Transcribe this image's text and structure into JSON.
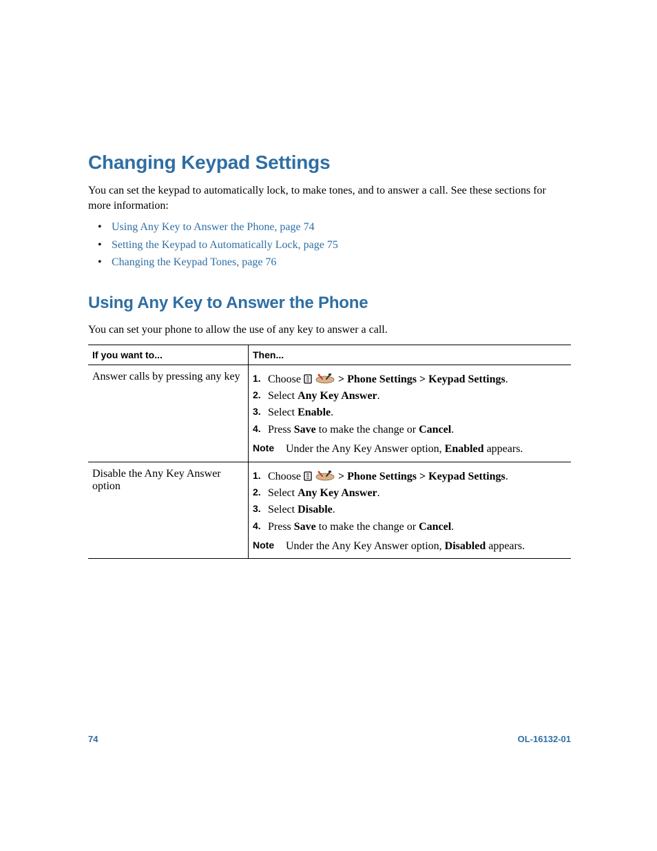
{
  "headings": {
    "h1": "Changing Keypad Settings",
    "h2": "Using Any Key to Answer the Phone"
  },
  "intro": "You can set the keypad to automatically lock, to make tones, and to answer a call. See these sections for more information:",
  "links": [
    "Using Any Key to Answer the Phone, page 74",
    "Setting the Keypad to Automatically Lock, page 75",
    "Changing the Keypad Tones, page 76"
  ],
  "section_intro": "You can set your phone to allow the use of any key to answer a call.",
  "table": {
    "headers": [
      "If you want to...",
      "Then..."
    ],
    "rows": [
      {
        "want": "Answer calls by pressing any key",
        "steps": [
          {
            "prefix": "Choose ",
            "icons": true,
            "suffix_bold": " > Phone Settings > Keypad Settings",
            "tail": "."
          },
          {
            "prefix": "Select ",
            "bold": "Any Key Answer",
            "tail": "."
          },
          {
            "prefix": "Select ",
            "bold": "Enable",
            "tail": "."
          },
          {
            "prefix": "Press ",
            "bold": "Save",
            "mid": " to make the change or ",
            "bold2": "Cancel",
            "tail": "."
          }
        ],
        "note": {
          "pre": "Under the Any Key Answer option, ",
          "bold": "Enabled",
          "post": " appears."
        }
      },
      {
        "want": "Disable the Any Key Answer option",
        "steps": [
          {
            "prefix": "Choose ",
            "icons": true,
            "suffix_bold": " > Phone Settings > Keypad Settings",
            "tail": "."
          },
          {
            "prefix": "Select ",
            "bold": "Any Key Answer",
            "tail": "."
          },
          {
            "prefix": "Select ",
            "bold": "Disable",
            "tail": "."
          },
          {
            "prefix": "Press ",
            "bold": "Save",
            "mid": " to make the change or ",
            "bold2": "Cancel",
            "tail": "."
          }
        ],
        "note": {
          "pre": "Under the Any Key Answer option, ",
          "bold": "Disabled",
          "post": " appears."
        }
      }
    ]
  },
  "note_label": "Note",
  "footer": {
    "page": "74",
    "doc": "OL-16132-01"
  }
}
